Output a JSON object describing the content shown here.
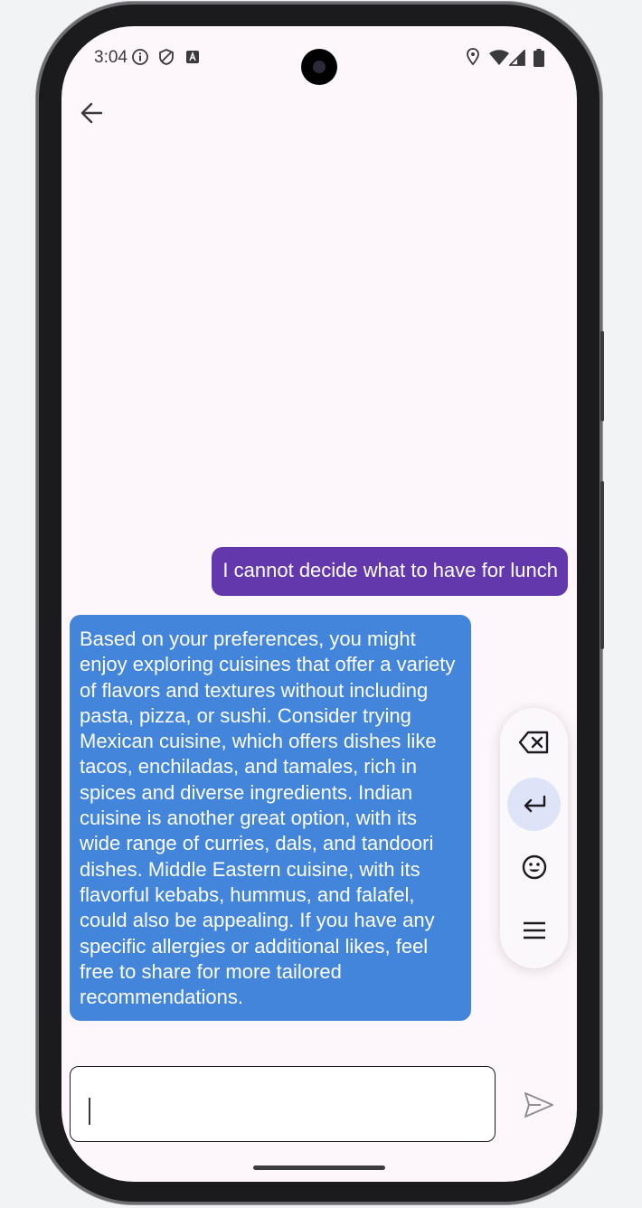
{
  "status_bar": {
    "time": "3:04",
    "left_icons": [
      "info-icon",
      "shield-icon",
      "keyboard-a-icon"
    ],
    "right_icons": [
      "location-icon",
      "wifi-icon",
      "signal-icon",
      "battery-icon"
    ]
  },
  "header": {
    "back_icon": "arrow-left-icon"
  },
  "messages": [
    {
      "role": "user",
      "text": "I cannot decide what to have for lunch",
      "color": "#6238ac"
    },
    {
      "role": "assistant",
      "text": "Based on your preferences, you might enjoy exploring cuisines that offer a variety of flavors and textures without including pasta, pizza, or sushi. Consider trying Mexican cuisine, which offers dishes like tacos, enchiladas, and tamales, rich in spices and diverse ingredients. Indian cuisine is another great option, with its wide range of curries, dals, and tandoori dishes. Middle Eastern cuisine, with its flavorful kebabs, hummus, and falafel, could also be appealing. If you have any specific allergies or additional likes, feel free to share for more tailored recommendations.",
      "color": "#4285da"
    }
  ],
  "keyboard_toolbar": {
    "buttons": [
      "backspace-icon",
      "enter-icon",
      "emoji-icon",
      "menu-icon"
    ],
    "active": "enter-icon"
  },
  "composer": {
    "value": "",
    "placeholder": ""
  },
  "send_icon": "send-icon"
}
